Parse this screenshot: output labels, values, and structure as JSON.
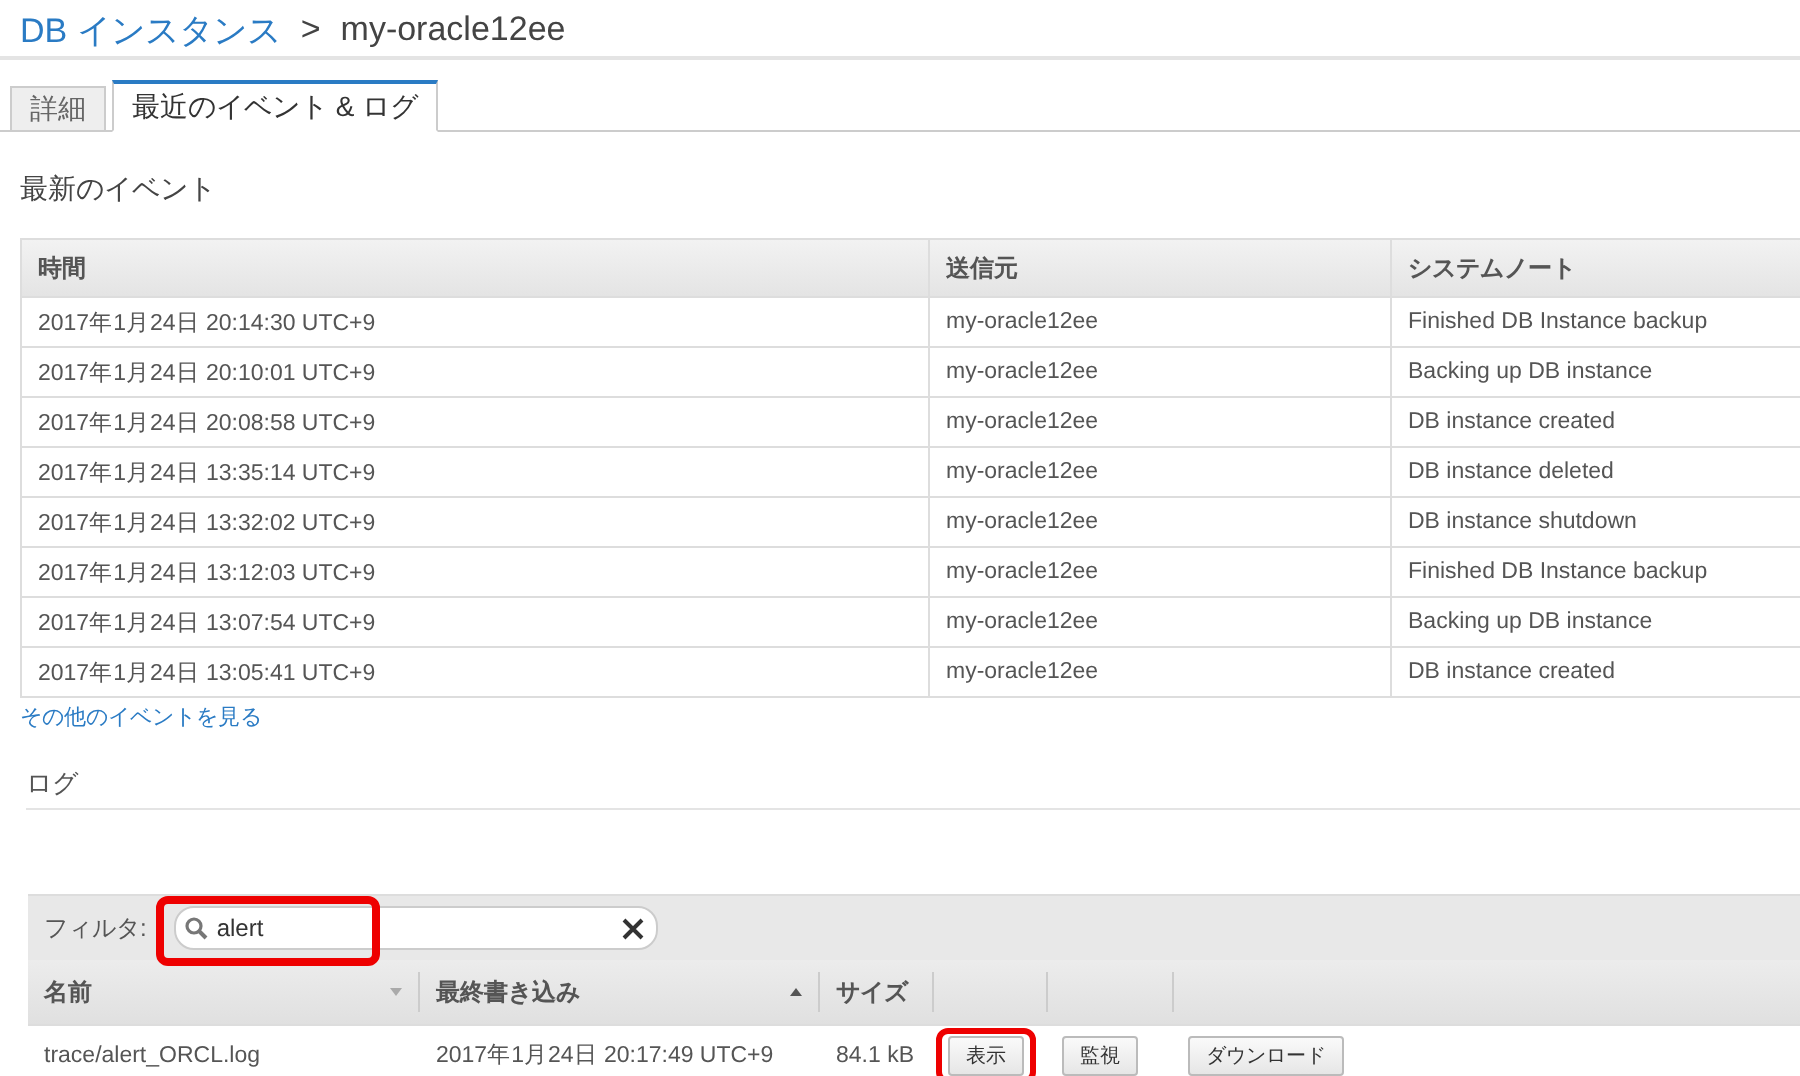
{
  "breadcrumb": {
    "parent": "DB インスタンス",
    "separator": ">",
    "current": "my-oracle12ee"
  },
  "tabs": [
    {
      "label": "詳細",
      "selected": false
    },
    {
      "label": "最近のイベント & ログ",
      "selected": true
    }
  ],
  "events": {
    "title": "最新のイベント",
    "columns": [
      "時間",
      "送信元",
      "システムノート"
    ],
    "rows": [
      [
        "2017年1月24日 20:14:30 UTC+9",
        "my-oracle12ee",
        "Finished DB Instance backup"
      ],
      [
        "2017年1月24日 20:10:01 UTC+9",
        "my-oracle12ee",
        "Backing up DB instance"
      ],
      [
        "2017年1月24日 20:08:58 UTC+9",
        "my-oracle12ee",
        "DB instance created"
      ],
      [
        "2017年1月24日 13:35:14 UTC+9",
        "my-oracle12ee",
        "DB instance deleted"
      ],
      [
        "2017年1月24日 13:32:02 UTC+9",
        "my-oracle12ee",
        "DB instance shutdown"
      ],
      [
        "2017年1月24日 13:12:03 UTC+9",
        "my-oracle12ee",
        "Finished DB Instance backup"
      ],
      [
        "2017年1月24日 13:07:54 UTC+9",
        "my-oracle12ee",
        "Backing up DB instance"
      ],
      [
        "2017年1月24日 13:05:41 UTC+9",
        "my-oracle12ee",
        "DB instance created"
      ]
    ],
    "more_link": "その他のイベントを見る"
  },
  "logs": {
    "title": "ログ",
    "filter": {
      "label": "フィルタ:",
      "value": "alert",
      "highlighted": true
    },
    "columns": [
      {
        "label": "名前",
        "sorted": false
      },
      {
        "label": "最終書き込み",
        "sorted": true
      },
      {
        "label": "サイズ"
      }
    ],
    "rows": [
      {
        "name": "trace/alert_ORCL.log",
        "written": "2017年1月24日 20:17:49 UTC+9",
        "size": "84.1 kB",
        "buttons": [
          {
            "label": "表示",
            "highlighted": true
          },
          {
            "label": "監視",
            "highlighted": false
          },
          {
            "label": "ダウンロード",
            "highlighted": false
          }
        ]
      }
    ]
  }
}
